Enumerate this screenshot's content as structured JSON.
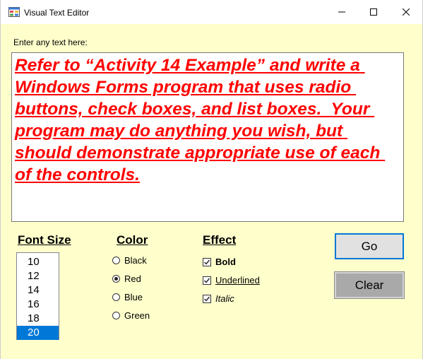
{
  "window": {
    "title": "Visual Text Editor",
    "buttons": {
      "minimize_icon": "minimize-icon",
      "maximize_icon": "maximize-icon",
      "close_icon": "close-icon"
    }
  },
  "editor": {
    "prompt": "Enter any text here:",
    "text": "Refer to “Activity 14 Example” and write a Windows Forms program that uses radio buttons, check boxes, and list boxes.  Your program may do anything you wish, but should demonstrate appropriate use of each of the controls.",
    "text_color": "#ff0000",
    "font_size_selected": "20",
    "bold": true,
    "underlined": true,
    "italic": true
  },
  "font_size": {
    "label": "Font Size",
    "options": [
      "10",
      "12",
      "14",
      "16",
      "18",
      "20"
    ],
    "selected": "20"
  },
  "color": {
    "label": "Color",
    "options": [
      "Black",
      "Red",
      "Blue",
      "Green"
    ],
    "selected": "Red"
  },
  "effect": {
    "label": "Effect",
    "options": [
      {
        "label": "Bold",
        "checked": true
      },
      {
        "label": "Underlined",
        "checked": true
      },
      {
        "label": "Italic",
        "checked": true
      }
    ]
  },
  "actions": {
    "go_label": "Go",
    "clear_label": "Clear"
  },
  "colors": {
    "form_background": "#ffffcc",
    "selection": "#0078d7",
    "text_red": "#ff0000"
  }
}
